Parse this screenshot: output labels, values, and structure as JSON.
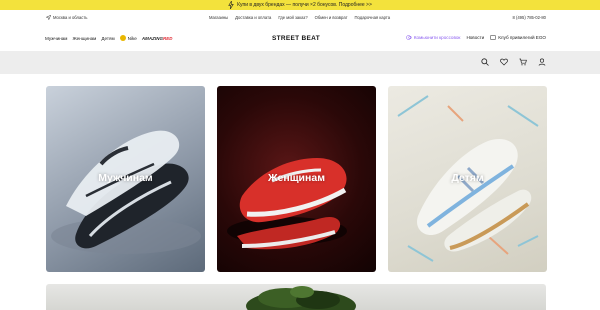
{
  "promo": {
    "text": "Купи в двух брендах — получи ×2 бонусов. Подробнее >>"
  },
  "topbar": {
    "region": "Москва и область",
    "links": [
      "Магазины",
      "Доставка и оплата",
      "Где мой заказ?",
      "Обмен и возврат",
      "Подарочная карта"
    ],
    "phone": "8 (495) 785-02-80"
  },
  "nav": {
    "items": [
      "Мужчинам",
      "Женщинам",
      "Детям"
    ],
    "nike": "Nike",
    "amazing_a": "AMAZING",
    "amazing_b": "RED",
    "logo": "STREET BEAT",
    "community": "Комьюнити кроссовок",
    "news": "Новости",
    "club": "Клуб привилегий EGO"
  },
  "icons": [
    "search-icon",
    "heart-icon",
    "cart-icon",
    "user-icon"
  ],
  "cards": [
    {
      "label": "Мужчинам"
    },
    {
      "label": "Женщинам"
    },
    {
      "label": "Детям"
    }
  ],
  "colors": {
    "promo": "#f3e23c",
    "community": "#8a5cf0",
    "search_strip": "#ededed"
  }
}
